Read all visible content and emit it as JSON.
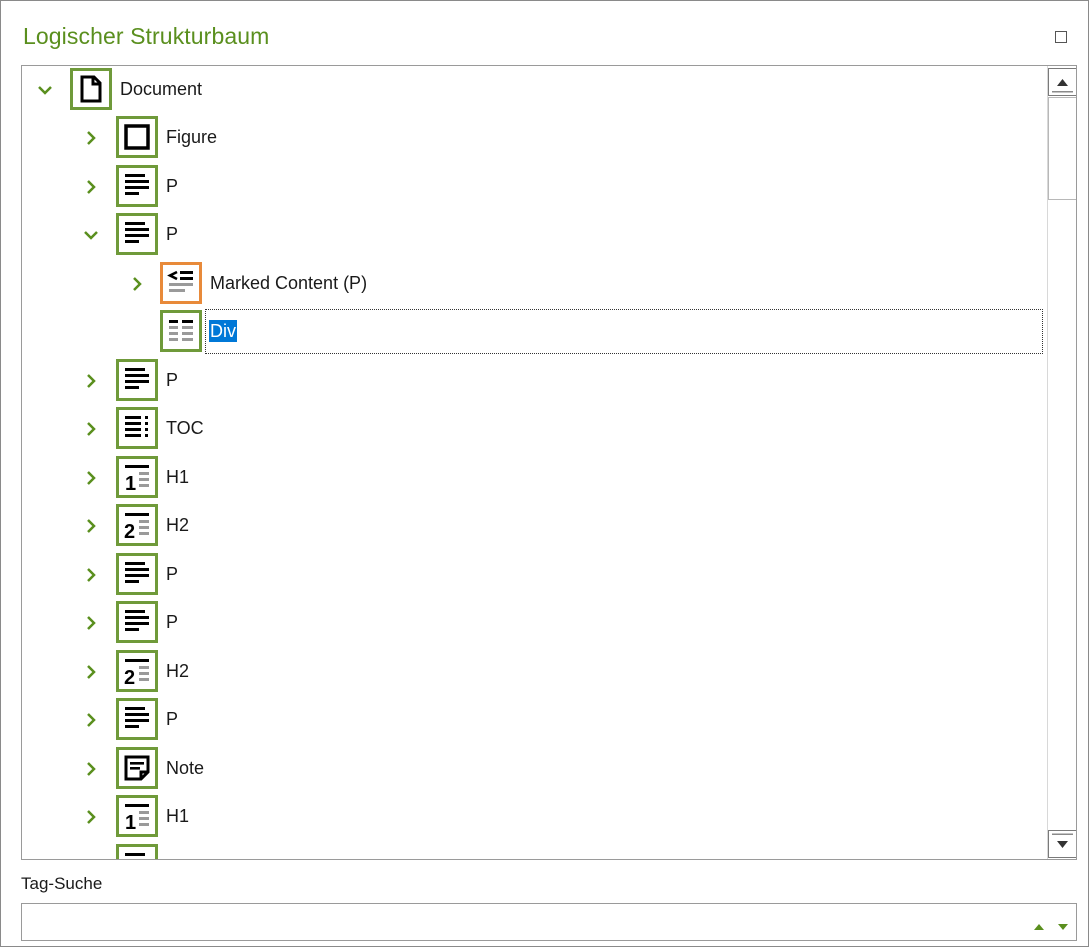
{
  "panel": {
    "title": "Logischer Strukturbaum",
    "maximize_icon": "maximize-icon"
  },
  "colors": {
    "title_green": "#5a8f1e",
    "tag_border_green": "#6f9a3a",
    "marked_content_orange": "#e88a3a",
    "selection_blue": "#0078d7"
  },
  "tree": {
    "rows": [
      {
        "label": "Document",
        "icon": "document-icon",
        "expander": "expanded"
      },
      {
        "label": "Figure",
        "icon": "figure-icon",
        "expander": "collapsed"
      },
      {
        "label": "P",
        "icon": "paragraph-icon",
        "expander": "collapsed"
      },
      {
        "label": "P",
        "icon": "paragraph-icon",
        "expander": "expanded"
      },
      {
        "label": "Marked Content (P)",
        "icon": "marked-content-icon",
        "expander": "collapsed"
      },
      {
        "label": "Div",
        "icon": "div-icon",
        "expander": "none",
        "selected": true
      },
      {
        "label": "P",
        "icon": "paragraph-icon",
        "expander": "collapsed"
      },
      {
        "label": "TOC",
        "icon": "toc-icon",
        "expander": "collapsed"
      },
      {
        "label": "H1",
        "icon": "heading-1-icon",
        "expander": "collapsed"
      },
      {
        "label": "H2",
        "icon": "heading-2-icon",
        "expander": "collapsed"
      },
      {
        "label": "P",
        "icon": "paragraph-icon",
        "expander": "collapsed"
      },
      {
        "label": "P",
        "icon": "paragraph-icon",
        "expander": "collapsed"
      },
      {
        "label": "H2",
        "icon": "heading-2-icon",
        "expander": "collapsed"
      },
      {
        "label": "P",
        "icon": "paragraph-icon",
        "expander": "collapsed"
      },
      {
        "label": "Note",
        "icon": "note-icon",
        "expander": "collapsed"
      },
      {
        "label": "H1",
        "icon": "heading-1-icon",
        "expander": "collapsed"
      },
      {
        "label": "",
        "icon": "paragraph-icon",
        "expander": "none"
      }
    ]
  },
  "search": {
    "label": "Tag-Suche",
    "value": "",
    "up_icon": "arrow-up-icon",
    "down_icon": "arrow-down-icon"
  }
}
